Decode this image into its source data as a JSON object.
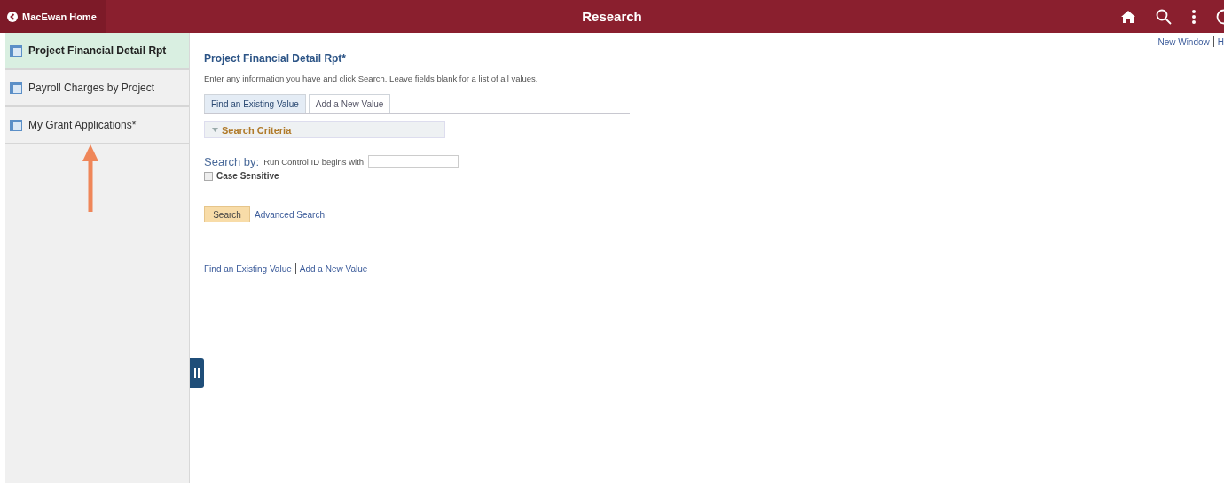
{
  "header": {
    "back_label": "MacEwan Home",
    "title": "Research"
  },
  "top_links": [
    "New Window",
    "H"
  ],
  "sidebar": {
    "items": [
      {
        "label": "Project Financial Detail Rpt",
        "selected": true
      },
      {
        "label": "Payroll Charges by Project",
        "selected": false
      },
      {
        "label": "My Grant Applications*",
        "selected": false
      }
    ]
  },
  "page": {
    "title": "Project Financial Detail Rpt*",
    "instructions": "Enter any information you have and click Search. Leave fields blank for a list of all values.",
    "tabs": [
      {
        "label": "Find an Existing Value",
        "selected": true
      },
      {
        "label": "Add a New Value",
        "selected": false
      }
    ],
    "section": {
      "label": "Search Criteria",
      "expanded": true
    },
    "search_by": "Search by:",
    "field_label": "Run Control ID begins with",
    "case_sensitive": {
      "label": "Case Sensitive",
      "checked": false
    },
    "search_button": "Search",
    "advanced_link": "Advanced Search",
    "bottom_links": [
      "Find an Existing Value",
      "Add a New Value"
    ]
  }
}
